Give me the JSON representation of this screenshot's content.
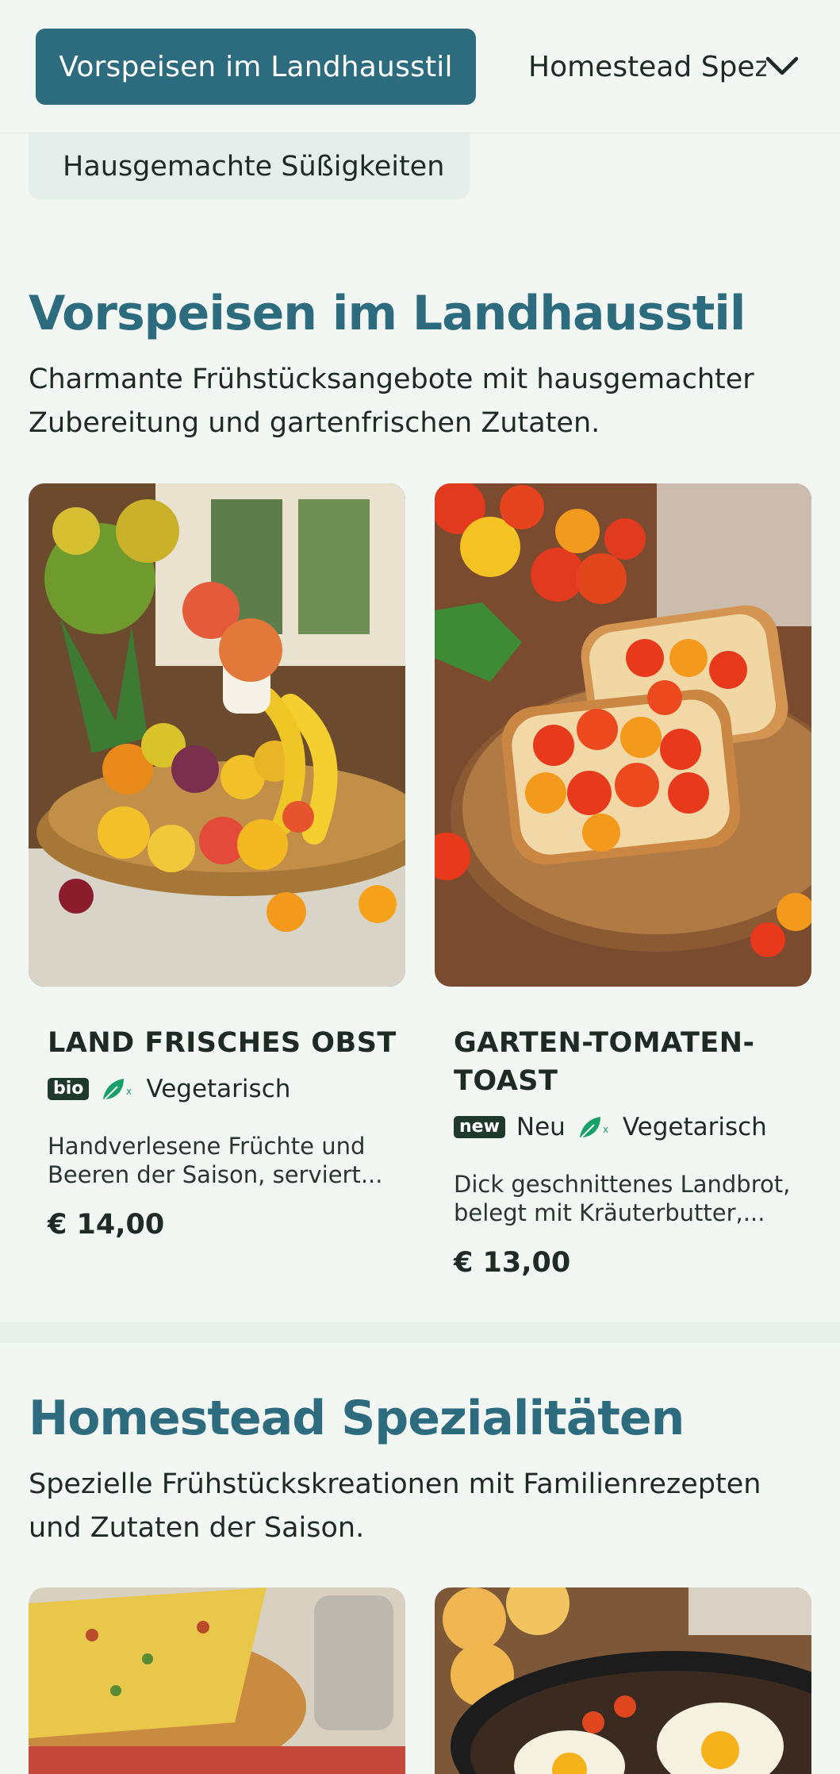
{
  "category_nav": {
    "active": "Vorspeisen im Landhausstil",
    "next": "Homestead Spezialitäten",
    "sub": "Hausgemachte Süßigkeiten"
  },
  "sections": [
    {
      "title": "Vorspeisen im Landhausstil",
      "description": "Charmante Frühstücksangebote mit hausgemachter Zubereitung und gartenfrischen Zutaten.",
      "items": [
        {
          "name": "LAND FRISCHES OBST",
          "badge": "bio",
          "diet": "Vegetarisch",
          "description": "Handverlesene Früchte und Beeren der Saison, serviert...",
          "price": "€ 14,00"
        },
        {
          "name": "GARTEN-TOMATEN-TOAST",
          "badge": "new",
          "badge_text": "Neu",
          "diet": "Vegetarisch",
          "description": "Dick geschnittenes Landbrot, belegt mit Kräuterbutter,...",
          "price": "€ 13,00"
        }
      ]
    },
    {
      "title": "Homestead Spezialitäten",
      "description": "Spezielle Frühstückskreationen mit Familienrezepten und Zutaten der Saison."
    }
  ],
  "icons": {
    "chevron": "chevron-down-icon",
    "diet": "leaf-icon"
  },
  "colors": {
    "accent": "#2d6b7e",
    "diet_icon": "#17a06a",
    "badge": "#1f3a2c"
  }
}
